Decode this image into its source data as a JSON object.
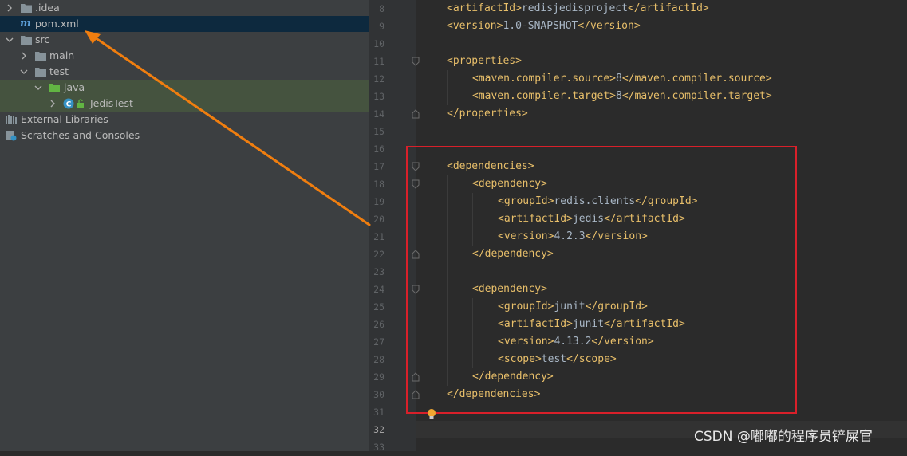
{
  "project_tree": {
    "items": [
      {
        "label": ".idea",
        "icon": "folder-icon"
      },
      {
        "label": "pom.xml",
        "icon": "maven-file-icon"
      },
      {
        "label": "src",
        "icon": "folder-icon"
      },
      {
        "label": "main",
        "icon": "folder-icon"
      },
      {
        "label": "test",
        "icon": "folder-icon"
      },
      {
        "label": "java",
        "icon": "test-source-folder-icon"
      },
      {
        "label": "JedisTest",
        "icon": "java-class-icon"
      },
      {
        "label": "External Libraries",
        "icon": "libraries-icon"
      },
      {
        "label": "Scratches and Consoles",
        "icon": "scratches-icon"
      }
    ],
    "selected": "pom.xml"
  },
  "editor": {
    "current_line": "32",
    "lines": [
      {
        "num": "8",
        "open": "<artifactId>",
        "text": "redisjedisproject",
        "close": "</artifactId>"
      },
      {
        "num": "9",
        "open": "<version>",
        "text": "1.0-SNAPSHOT",
        "close": "</version>"
      },
      {
        "num": "10",
        "open": "",
        "text": "",
        "close": ""
      },
      {
        "num": "11",
        "open": "<properties>",
        "text": "",
        "close": ""
      },
      {
        "num": "12",
        "open": "<maven.compiler.source>",
        "text": "8",
        "close": "</maven.compiler.source>"
      },
      {
        "num": "13",
        "open": "<maven.compiler.target>",
        "text": "8",
        "close": "</maven.compiler.target>"
      },
      {
        "num": "14",
        "open": "</properties>",
        "text": "",
        "close": ""
      },
      {
        "num": "15",
        "open": "",
        "text": "",
        "close": ""
      },
      {
        "num": "16",
        "open": "",
        "text": "",
        "close": ""
      },
      {
        "num": "17",
        "open": "<dependencies>",
        "text": "",
        "close": ""
      },
      {
        "num": "18",
        "open": "<dependency>",
        "text": "",
        "close": ""
      },
      {
        "num": "19",
        "open": "<groupId>",
        "text": "redis.clients",
        "close": "</groupId>"
      },
      {
        "num": "20",
        "open": "<artifactId>",
        "text": "jedis",
        "close": "</artifactId>"
      },
      {
        "num": "21",
        "open": "<version>",
        "text": "4.2.3",
        "close": "</version>"
      },
      {
        "num": "22",
        "open": "</dependency>",
        "text": "",
        "close": ""
      },
      {
        "num": "23",
        "open": "",
        "text": "",
        "close": ""
      },
      {
        "num": "24",
        "open": "<dependency>",
        "text": "",
        "close": ""
      },
      {
        "num": "25",
        "open": "<groupId>",
        "text": "junit",
        "close": "</groupId>"
      },
      {
        "num": "26",
        "open": "<artifactId>",
        "text": "junit",
        "close": "</artifactId>"
      },
      {
        "num": "27",
        "open": "<version>",
        "text": "4.13.2",
        "close": "</version>"
      },
      {
        "num": "28",
        "open": "<scope>",
        "text": "test",
        "close": "</scope>"
      },
      {
        "num": "29",
        "open": "</dependency>",
        "text": "",
        "close": ""
      },
      {
        "num": "30",
        "open": "</dependencies>",
        "text": "",
        "close": ""
      },
      {
        "num": "31",
        "open": "",
        "text": "",
        "close": ""
      },
      {
        "num": "32",
        "open": "",
        "text": "",
        "close": ""
      },
      {
        "num": "33",
        "open": "",
        "text": "",
        "close": ""
      }
    ]
  },
  "annotation": {
    "arrow_color": "#f07e0f",
    "box_color": "#d9202a"
  },
  "watermark": "CSDN @嘟嘟的程序员铲屎官",
  "colors": {
    "tag": "#e8bf6a",
    "text": "#a9b7c6",
    "line_number": "#606366",
    "selection": "#0d293e",
    "test_folder_highlight": "#45533f"
  }
}
